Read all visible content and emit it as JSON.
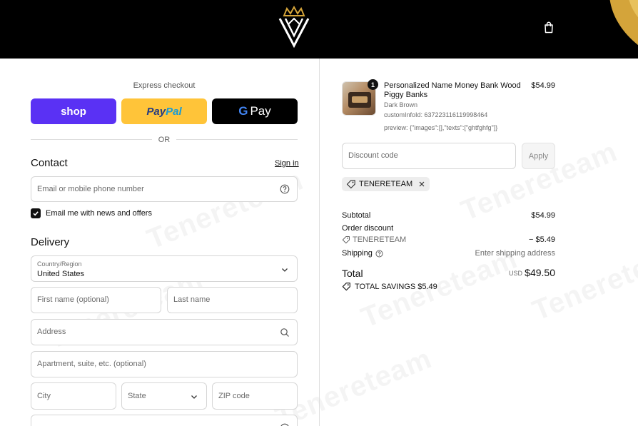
{
  "header": {
    "logo_icon": "crown-w-logo",
    "cart_icon": "shopping-bag-icon"
  },
  "express": {
    "label": "Express checkout",
    "shop_label": "shop",
    "paypal_part1": "Pay",
    "paypal_part2": "Pal",
    "gpay_g": "G",
    "gpay_label": "Pay",
    "or_label": "OR"
  },
  "contact": {
    "title": "Contact",
    "signin_label": "Sign in",
    "email_placeholder": "Email or mobile phone number",
    "newsletter_label": "Email me with news and offers",
    "newsletter_checked": true
  },
  "delivery": {
    "title": "Delivery",
    "country_label": "Country/Region",
    "country_value": "United States",
    "first_name_placeholder": "First name (optional)",
    "last_name_placeholder": "Last name",
    "address_placeholder": "Address",
    "apartment_placeholder": "Apartment, suite, etc. (optional)",
    "city_placeholder": "City",
    "state_placeholder": "State",
    "zip_placeholder": "ZIP code"
  },
  "order": {
    "item": {
      "quantity": "1",
      "title": "Personalized Name Money Bank Wood Piggy Banks",
      "variant": "Dark Brown",
      "custom_info": "customInfoId: 637223116119998464",
      "preview": "preview: {\"images\":[],\"texts\":[\"ghtfghfg\"]}",
      "price": "$54.99"
    },
    "discount_placeholder": "Discount code",
    "apply_label": "Apply",
    "applied_code": "TENERETEAM",
    "subtotal_label": "Subtotal",
    "subtotal_value": "$54.99",
    "order_discount_label": "Order discount",
    "discount_code_label": "TENERETEAM",
    "discount_value": "− $5.49",
    "shipping_label": "Shipping",
    "shipping_value": "Enter shipping address",
    "total_label": "Total",
    "total_currency": "USD",
    "total_value": "$49.50",
    "savings_label": "TOTAL SAVINGS $5.49"
  },
  "watermark_text": "Tenereteam"
}
